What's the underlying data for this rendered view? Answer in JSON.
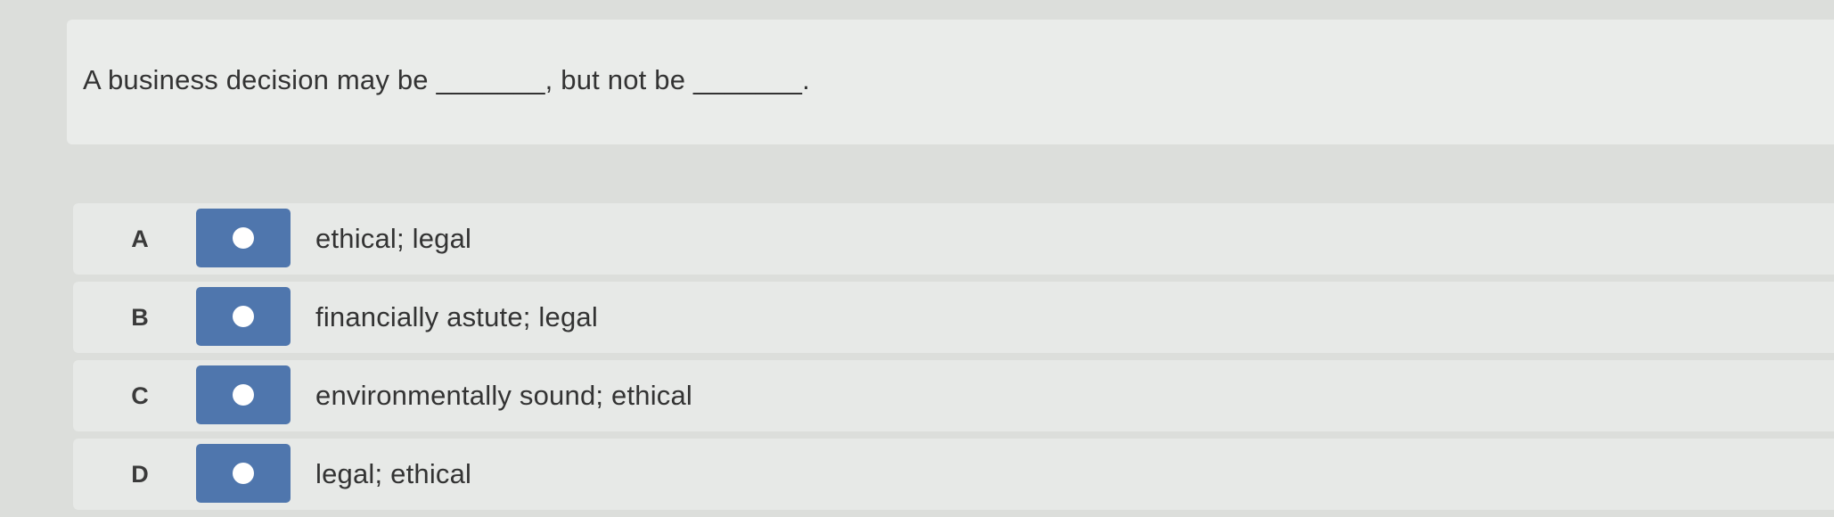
{
  "question": {
    "text": "A business decision may be _______, but not be _______."
  },
  "options": [
    {
      "letter": "A",
      "text": "ethical; legal",
      "radio_icon": "radio-circle-icon"
    },
    {
      "letter": "B",
      "text": "financially astute; legal",
      "radio_icon": "radio-circle-icon"
    },
    {
      "letter": "C",
      "text": "environmentally sound; ethical",
      "radio_icon": "radio-circle-icon"
    },
    {
      "letter": "D",
      "text": "legal; ethical",
      "radio_icon": "radio-circle-icon"
    }
  ],
  "colors": {
    "radio_button": "#4f76ad",
    "radio_dot": "#ffffff",
    "background": "#dcdedb",
    "card": "#e7e9e7"
  }
}
